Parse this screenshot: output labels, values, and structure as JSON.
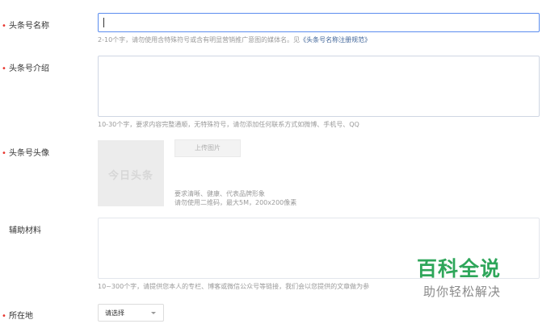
{
  "fields": {
    "name": {
      "label": "头条号名称",
      "value": "",
      "hint_prefix": "2-10个字，请勿使用含特殊符号或含有明显营销推广意图的媒体名。见",
      "hint_link": "《头条号名称注册规范》"
    },
    "intro": {
      "label": "头条号介绍",
      "value": "",
      "hint": "10-30个字，要求内容完整通顺，无特殊符号，请勿添加任何联系方式如微博、手机号、QQ"
    },
    "avatar": {
      "label": "头条号头像",
      "placeholder_text": "今日头条",
      "upload_label": "上传图片",
      "hint_line1": "要求清晰、健康、代表品牌形象",
      "hint_line2": "请勿使用二维码，最大5M，200x200像素"
    },
    "materials": {
      "label": "辅助材料",
      "value": "",
      "hint": "10~300个字，请提供您本人的专栏、博客或微信公众号等链接，我们会以您提供的文章做为参"
    },
    "location": {
      "label": "所在地",
      "selected": "请选择"
    }
  },
  "required_marker": "•",
  "watermark": {
    "title": "百科全说",
    "subtitle": "助你轻松解决"
  },
  "colors": {
    "required": "#e8342c",
    "focus_border": "#5b8def",
    "link": "#406599",
    "watermark_green": "#2ea65a"
  }
}
